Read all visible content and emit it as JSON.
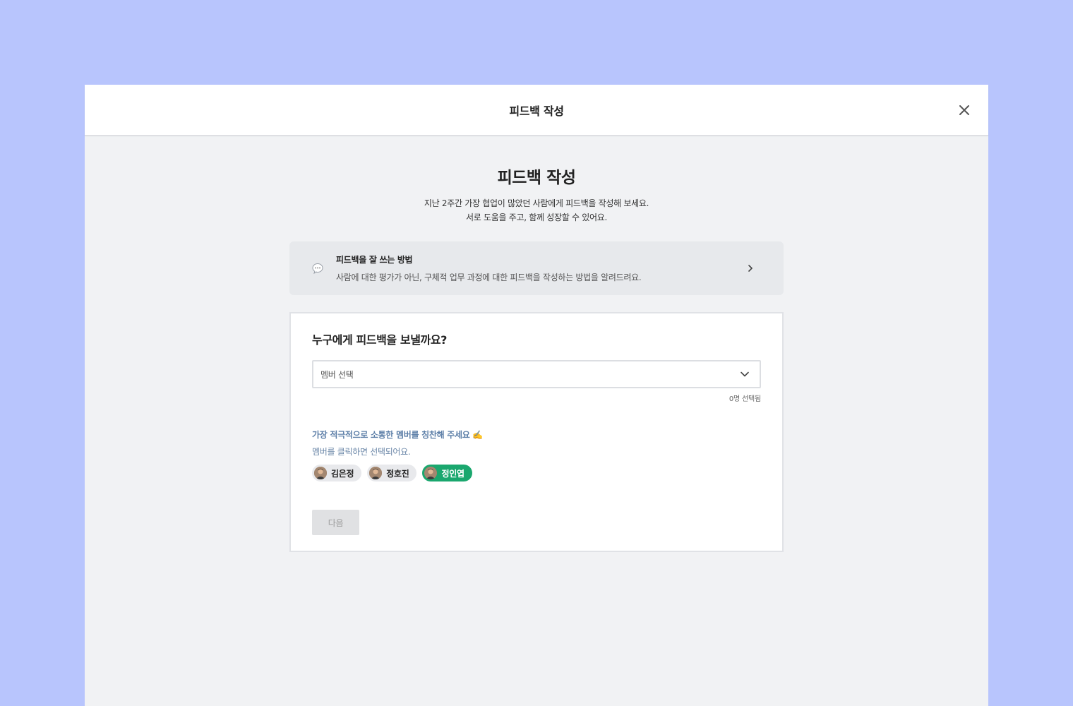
{
  "modal": {
    "header_title": "피드백 작성"
  },
  "main": {
    "title": "피드백 작성",
    "subtitle_line1": "지난 2주간 가장 협업이 많았던 사람에게 피드백을 작성해 보세요.",
    "subtitle_line2": "서로 도움을 주고, 함께 성장할 수 있어요."
  },
  "guide": {
    "title": "피드백을 잘 쓰는 방법",
    "description": "사람에 대한 평가가 아닌, 구체적 업무 과정에 대한 피드백을 작성하는 방법을 알려드려요."
  },
  "form": {
    "question": "누구에게 피드백을 보낼까요?",
    "select_placeholder": "멤버 선택",
    "selected_count": "0명 선택됨",
    "praise_title": "가장 적극적으로 소통한 멤버를 칭찬해 주세요 ✍️",
    "praise_desc": "멤버를 클릭하면 선택되어요.",
    "members": [
      {
        "name": "김은정",
        "selected": false
      },
      {
        "name": "정호진",
        "selected": false
      },
      {
        "name": "정인엽",
        "selected": true
      }
    ],
    "next_label": "다음"
  },
  "colors": {
    "background": "#b8c5fd",
    "accent_green": "#1aa76e",
    "link_blue": "#5d7fa8"
  }
}
